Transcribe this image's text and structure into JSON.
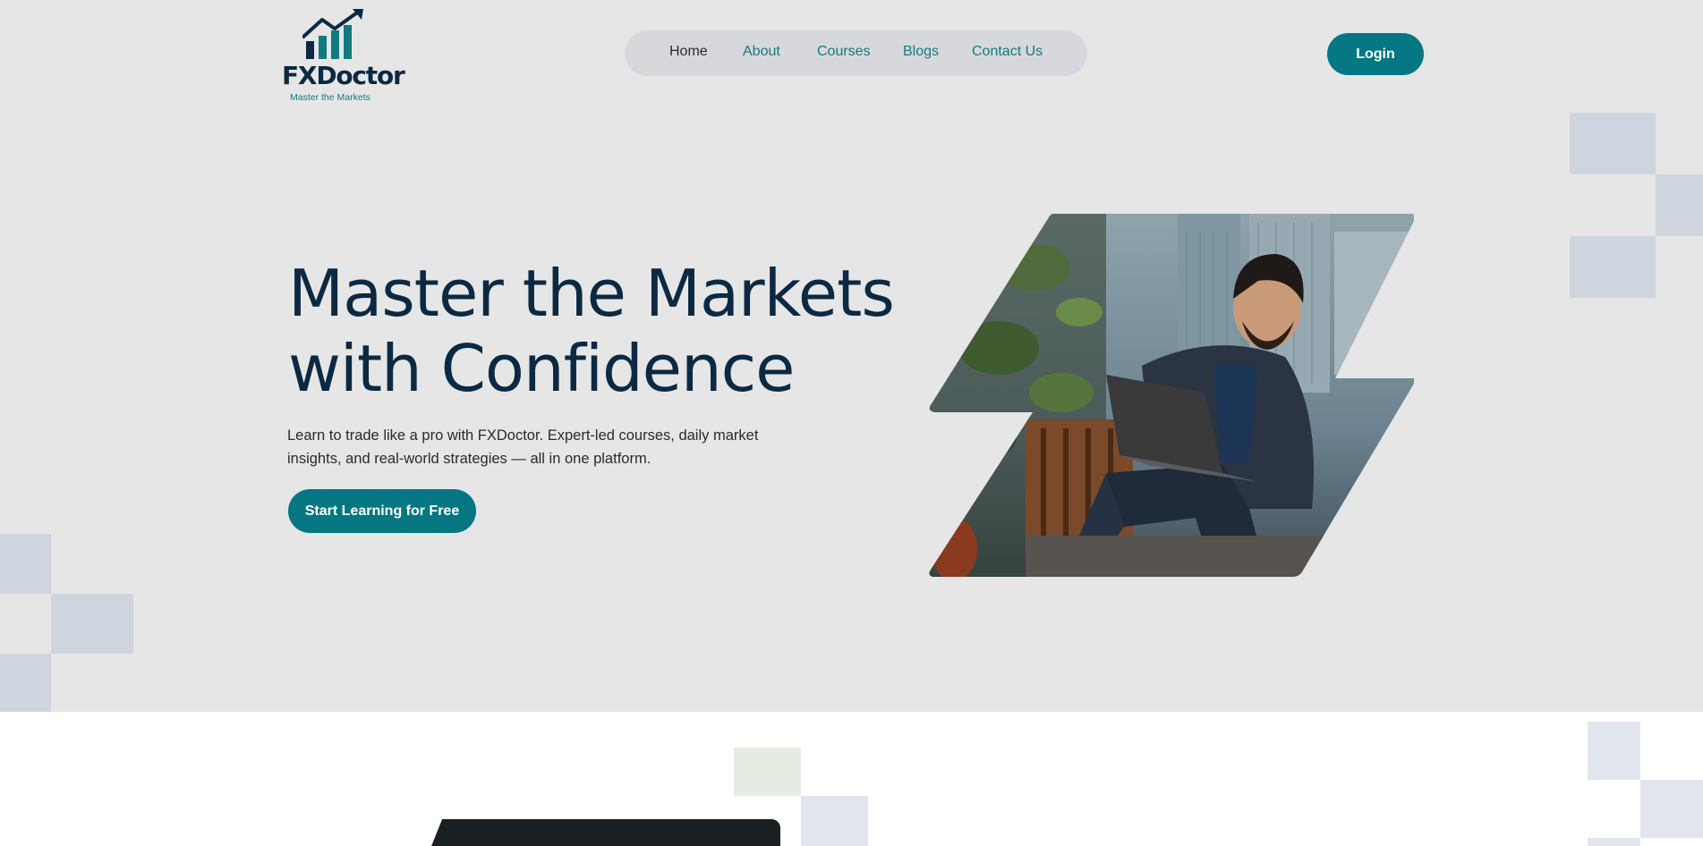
{
  "brand": {
    "name": "FXDoctor",
    "tagline": "Master the Markets",
    "primary_color": "#047783",
    "heading_color": "#0b2942"
  },
  "nav": {
    "items": [
      {
        "label": "Home",
        "active": true
      },
      {
        "label": "About",
        "active": false
      },
      {
        "label": "Courses",
        "active": false
      },
      {
        "label": "Blogs",
        "active": false
      },
      {
        "label": "Contact Us",
        "active": false
      }
    ]
  },
  "header": {
    "login_label": "Login"
  },
  "hero": {
    "title_line1": "Master the Markets",
    "title_line2": "with Confidence",
    "description": "Learn to trade like a pro with FXDoctor. Expert-led courses, daily market insights, and real-world strategies — all in one platform.",
    "cta_label": "Start Learning for Free",
    "image_icon": "man-with-laptop-photo"
  }
}
